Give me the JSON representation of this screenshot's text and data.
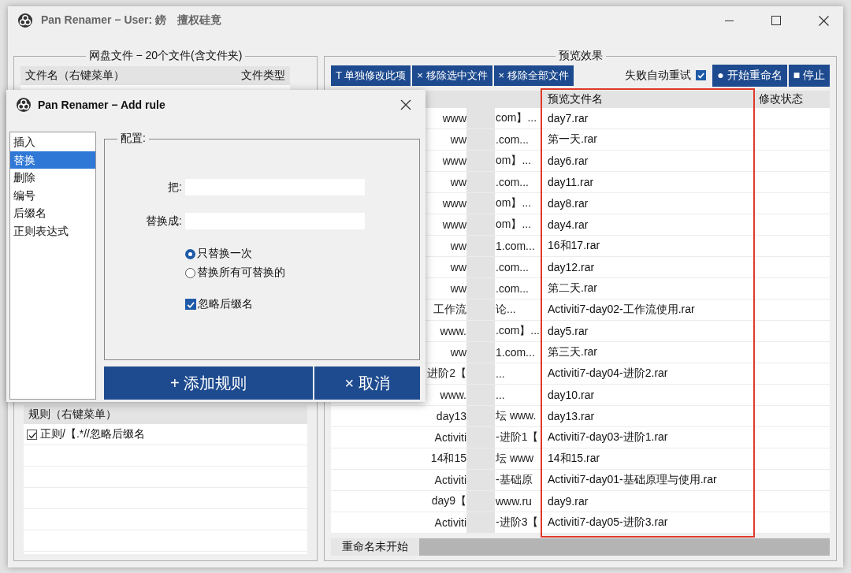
{
  "window": {
    "title": "Pan Renamer − User: 鎊　擅权硅竟"
  },
  "files_panel": {
    "title": "网盘文件 − 20个文件(含文件夹)",
    "columns": [
      "文件名（右键菜单）",
      "文件类型"
    ]
  },
  "rules_panel": {
    "columns": [
      "规则（右键菜单）"
    ],
    "rules": [
      {
        "label": "正则/【.*//忽略后缀名",
        "checked": true
      }
    ]
  },
  "preview_panel": {
    "title": "预览效果",
    "toolbar": [
      "T 单独修改此项",
      "× 移除选中文件",
      "× 移除全部文件"
    ],
    "retry": {
      "label": "失败自动重试",
      "checked": true
    },
    "actions": [
      "● 开始重命名",
      "■ 停止"
    ],
    "columns": [
      "预览文件名",
      "修改状态"
    ],
    "rows": [
      {
        "name_start": "www",
        "name_end": "com】...",
        "preview": "day7.rar"
      },
      {
        "name_start": "ww",
        "name_end": ".com...",
        "preview": "第一天.rar"
      },
      {
        "name_start": "www",
        "name_end": "om】...",
        "preview": "day6.rar"
      },
      {
        "name_start": "ww",
        "name_end": ".com...",
        "preview": "day11.rar"
      },
      {
        "name_start": "www",
        "name_end": "om】...",
        "preview": "day8.rar"
      },
      {
        "name_start": "www",
        "name_end": "om】...",
        "preview": "day4.rar"
      },
      {
        "name_start": "ww",
        "name_end": "1.com...",
        "preview": "16和17.rar"
      },
      {
        "name_start": "ww",
        "name_end": ".com...",
        "preview": "day12.rar"
      },
      {
        "name_start": "ww",
        "name_end": ".com...",
        "preview": "第二天.rar"
      },
      {
        "name_start": "工作流",
        "name_end": "论...",
        "preview": "Activiti7-day02-工作流使用.rar"
      },
      {
        "name_start": "www.",
        "name_end": ".com】...",
        "preview": "day5.rar"
      },
      {
        "name_start": "ww",
        "name_end": "1.com...",
        "preview": "第三天.rar"
      },
      {
        "name_start": "进阶2【",
        "name_end": "...",
        "preview": "Activiti7-day04-进阶2.rar"
      },
      {
        "name_start": "www.",
        "name_end": "...",
        "preview": "day10.rar"
      },
      {
        "name_start": "day13",
        "name_end": "坛 www.",
        "preview": "day13.rar"
      },
      {
        "name_start": "Activiti",
        "name_end": "-进阶1【",
        "preview": "Activiti7-day03-进阶1.rar"
      },
      {
        "name_start": "14和15",
        "name_end": "坛 www",
        "preview": "14和15.rar"
      },
      {
        "name_start": "Activiti",
        "name_end": "-基础原",
        "preview": "Activiti7-day01-基础原理与使用.rar"
      },
      {
        "name_start": "day9【",
        "name_end": "www.ru",
        "preview": "day9.rar"
      },
      {
        "name_start": "Activiti",
        "name_end": "-进阶3【",
        "preview": "Activiti7-day05-进阶3.rar"
      }
    ],
    "status": {
      "text": "重命名未开始"
    }
  },
  "dialog": {
    "title": "Pan Renamer − Add rule",
    "rule_types": [
      {
        "label": "插入",
        "selected": false
      },
      {
        "label": "替换",
        "selected": true
      },
      {
        "label": "删除",
        "selected": false
      },
      {
        "label": "编号",
        "selected": false
      },
      {
        "label": "后缀名",
        "selected": false
      },
      {
        "label": "正则表达式",
        "selected": false
      }
    ],
    "group_title": "配置:",
    "fields": [
      {
        "label": "把:"
      },
      {
        "label": "替换成:"
      }
    ],
    "options": [
      {
        "label": "只替换一次",
        "selected": true
      },
      {
        "label": "替换所有可替换的",
        "selected": false
      }
    ],
    "ignore_ext": {
      "label": "忽略后缀名",
      "checked": true
    },
    "buttons": [
      "+ 添加规则",
      "× 取消"
    ]
  }
}
